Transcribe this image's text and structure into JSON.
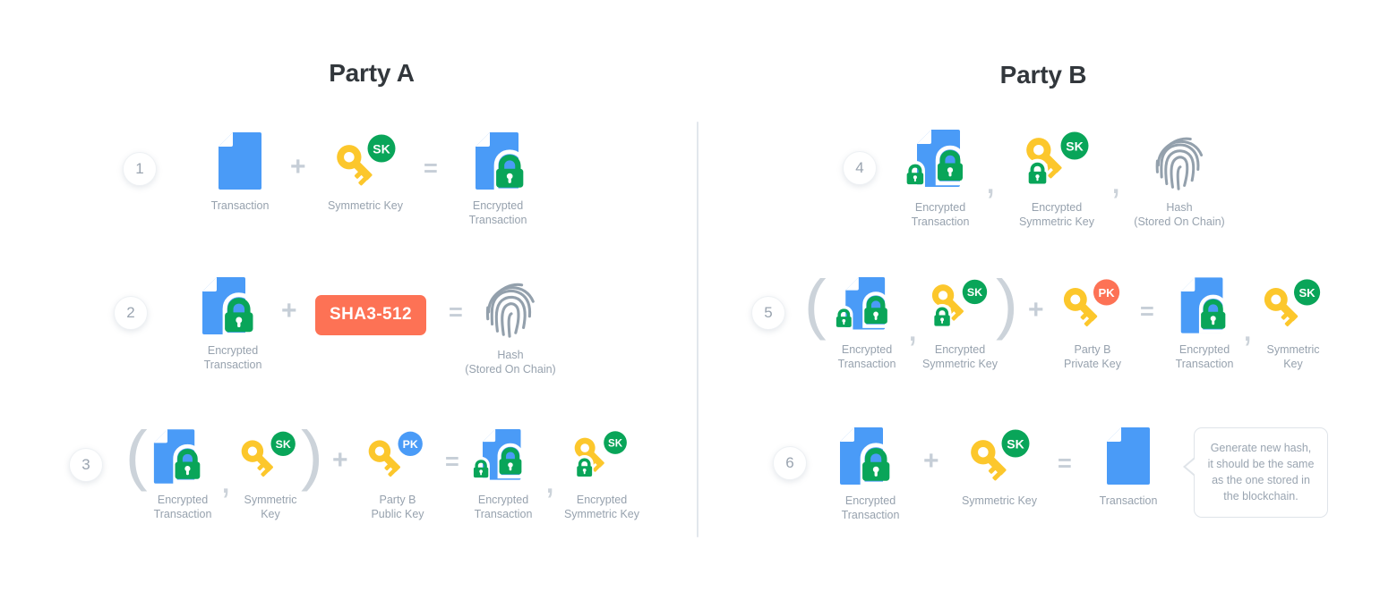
{
  "parties": {
    "a": {
      "title": "Party A"
    },
    "b": {
      "title": "Party B"
    }
  },
  "colors": {
    "document": "#4a9bf7",
    "lock": "#09a559",
    "key": "#fcc72c",
    "sk_badge": "#09a559",
    "pk_public_badge": "#4a9bf7",
    "pk_private_badge": "#fd7255",
    "sha_badge": "#fd7255",
    "fingerprint": "#93a0ac",
    "caption_text": "#97a2ae",
    "operator": "#c6ced7",
    "title_text": "#32373c",
    "divider": "#e2e7ec"
  },
  "operators": {
    "plus": "+",
    "equals": "=",
    "comma": ",",
    "paren_open": "(",
    "paren_close": ")"
  },
  "badges": {
    "sk": "SK",
    "pk": "PK",
    "sha": "SHA3-512"
  },
  "steps": [
    {
      "number": "1",
      "party": "a",
      "items": [
        {
          "name": "transaction",
          "caption": "Transaction"
        },
        {
          "name": "symmetric-key",
          "caption": "Symmetric Key"
        },
        {
          "name": "encrypted-transaction",
          "caption": "Encrypted\nTransaction"
        }
      ]
    },
    {
      "number": "2",
      "party": "a",
      "items": [
        {
          "name": "encrypted-transaction",
          "caption": "Encrypted\nTransaction"
        },
        {
          "name": "sha-algorithm",
          "caption": ""
        },
        {
          "name": "hash",
          "caption": "Hash\n(Stored On Chain)"
        }
      ]
    },
    {
      "number": "3",
      "party": "a",
      "items": [
        {
          "name": "encrypted-transaction",
          "caption": "Encrypted\nTransaction"
        },
        {
          "name": "symmetric-key",
          "caption": "Symmetric\nKey"
        },
        {
          "name": "party-b-public-key",
          "caption": "Party B\nPublic Key"
        },
        {
          "name": "encrypted-transaction",
          "caption": "Encrypted\nTransaction"
        },
        {
          "name": "encrypted-symmetric-key",
          "caption": "Encrypted\nSymmetric Key"
        }
      ]
    },
    {
      "number": "4",
      "party": "b",
      "items": [
        {
          "name": "encrypted-transaction",
          "caption": "Encrypted\nTransaction"
        },
        {
          "name": "encrypted-symmetric-key",
          "caption": "Encrypted\nSymmetric Key"
        },
        {
          "name": "hash",
          "caption": "Hash\n(Stored On Chain)"
        }
      ]
    },
    {
      "number": "5",
      "party": "b",
      "items": [
        {
          "name": "encrypted-transaction",
          "caption": "Encrypted\nTransaction"
        },
        {
          "name": "encrypted-symmetric-key",
          "caption": "Encrypted\nSymmetric Key"
        },
        {
          "name": "party-b-private-key",
          "caption": "Party B\nPrivate Key"
        },
        {
          "name": "encrypted-transaction",
          "caption": "Encrypted\nTransaction"
        },
        {
          "name": "symmetric-key",
          "caption": "Symmetric\nKey"
        }
      ]
    },
    {
      "number": "6",
      "party": "b",
      "items": [
        {
          "name": "encrypted-transaction",
          "caption": "Encrypted\nTransaction"
        },
        {
          "name": "symmetric-key",
          "caption": "Symmetric Key"
        },
        {
          "name": "transaction",
          "caption": "Transaction"
        }
      ]
    }
  ],
  "tooltip": {
    "text": "Generate new hash, it should be the same as the one stored in the blockchain."
  }
}
